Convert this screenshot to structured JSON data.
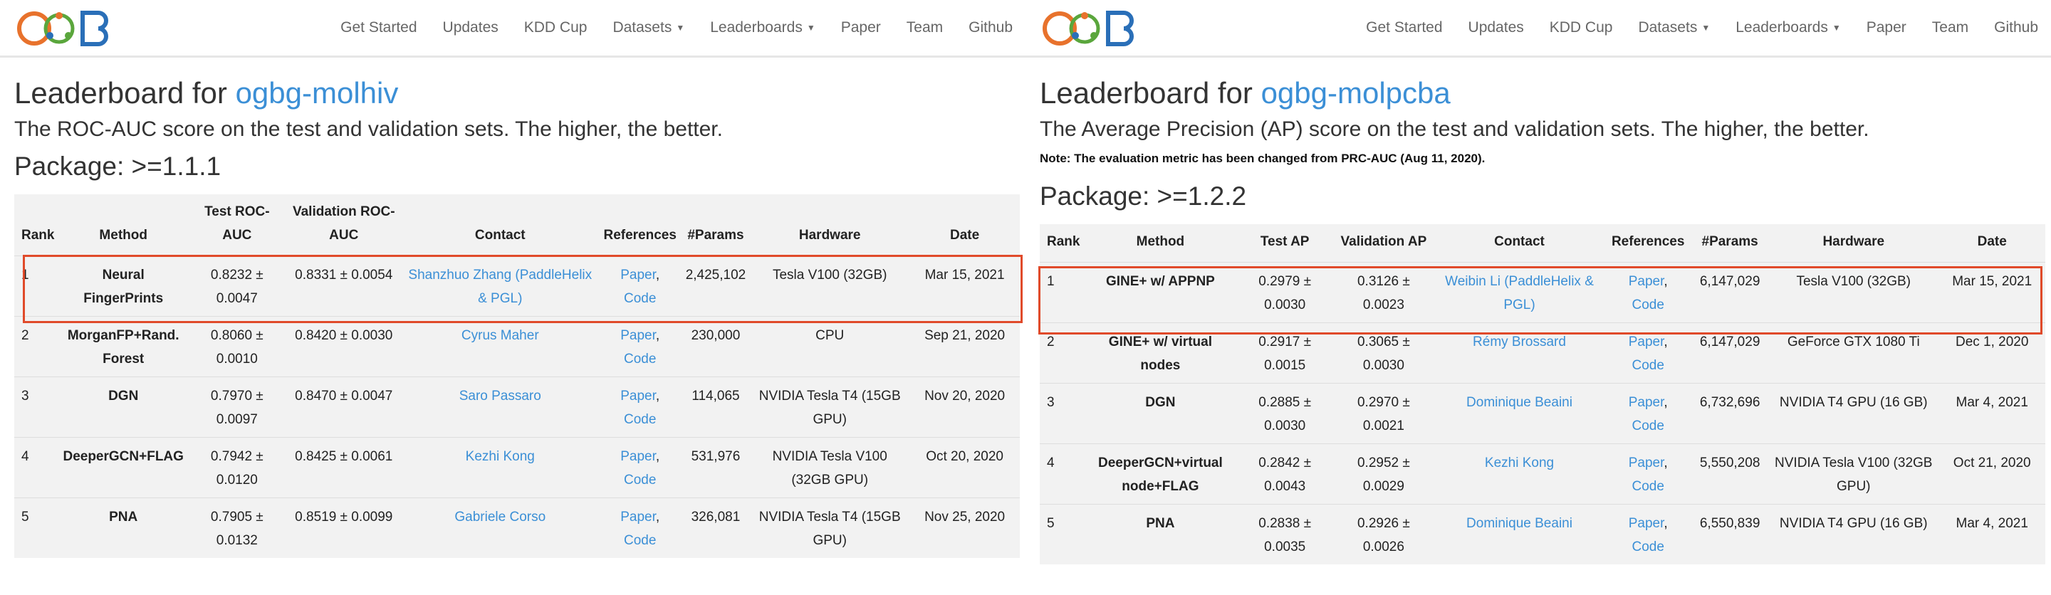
{
  "nav": {
    "links": [
      "Get Started",
      "Updates",
      "KDD Cup",
      "Datasets",
      "Leaderboards",
      "Paper",
      "Team",
      "Github"
    ]
  },
  "colors": {
    "link": "#3b8fd6",
    "highlight": "#e04a2a",
    "logo_orange": "#e8722c",
    "logo_blue": "#2a6fb8",
    "logo_green": "#5aa63c"
  },
  "left": {
    "title_prefix": "Leaderboard for",
    "dataset": "ogbg-molhiv",
    "subtitle": "The ROC-AUC score on the test and validation sets. The higher, the better.",
    "package": "Package: >=1.1.1",
    "headers": [
      "Rank",
      "Method",
      "Test ROC-AUC",
      "Validation ROC-AUC",
      "Contact",
      "References",
      "#Params",
      "Hardware",
      "Date"
    ],
    "rows": [
      {
        "rank": "1",
        "method": "Neural FingerPrints",
        "test": "0.8232 ± 0.0047",
        "valid": "0.8331 ± 0.0054",
        "contact": "Shanzhuo Zhang (PaddleHelix & PGL)",
        "paper": "Paper",
        "code": "Code",
        "params": "2,425,102",
        "hardware": "Tesla V100 (32GB)",
        "date": "Mar 15, 2021"
      },
      {
        "rank": "2",
        "method": "MorganFP+Rand. Forest",
        "test": "0.8060 ± 0.0010",
        "valid": "0.8420 ± 0.0030",
        "contact": "Cyrus Maher",
        "paper": "Paper",
        "code": "Code",
        "params": "230,000",
        "hardware": "CPU",
        "date": "Sep 21, 2020"
      },
      {
        "rank": "3",
        "method": "DGN",
        "test": "0.7970 ± 0.0097",
        "valid": "0.8470 ± 0.0047",
        "contact": "Saro Passaro",
        "paper": "Paper",
        "code": "Code",
        "params": "114,065",
        "hardware": "NVIDIA Tesla T4 (15GB GPU)",
        "date": "Nov 20, 2020"
      },
      {
        "rank": "4",
        "method": "DeeperGCN+FLAG",
        "test": "0.7942 ± 0.0120",
        "valid": "0.8425 ± 0.0061",
        "contact": "Kezhi Kong",
        "paper": "Paper",
        "code": "Code",
        "params": "531,976",
        "hardware": "NVIDIA Tesla V100 (32GB GPU)",
        "date": "Oct 20, 2020"
      },
      {
        "rank": "5",
        "method": "PNA",
        "test": "0.7905 ± 0.0132",
        "valid": "0.8519 ± 0.0099",
        "contact": "Gabriele Corso",
        "paper": "Paper",
        "code": "Code",
        "params": "326,081",
        "hardware": "NVIDIA Tesla T4 (15GB GPU)",
        "date": "Nov 25, 2020"
      }
    ]
  },
  "right": {
    "title_prefix": "Leaderboard for",
    "dataset": "ogbg-molpcba",
    "subtitle": "The Average Precision (AP) score on the test and validation sets. The higher, the better.",
    "note": "Note: The evaluation metric has been changed from PRC-AUC (Aug 11, 2020).",
    "package": "Package: >=1.2.2",
    "headers": [
      "Rank",
      "Method",
      "Test AP",
      "Validation AP",
      "Contact",
      "References",
      "#Params",
      "Hardware",
      "Date"
    ],
    "rows": [
      {
        "rank": "1",
        "method": "GINE+ w/ APPNP",
        "test": "0.2979 ± 0.0030",
        "valid": "0.3126 ± 0.0023",
        "contact": "Weibin Li (PaddleHelix & PGL)",
        "paper": "Paper",
        "code": "Code",
        "params": "6,147,029",
        "hardware": "Tesla V100 (32GB)",
        "date": "Mar 15, 2021"
      },
      {
        "rank": "2",
        "method": "GINE+ w/ virtual nodes",
        "test": "0.2917 ± 0.0015",
        "valid": "0.3065 ± 0.0030",
        "contact": "Rémy Brossard",
        "paper": "Paper",
        "code": "Code",
        "params": "6,147,029",
        "hardware": "GeForce GTX 1080 Ti",
        "date": "Dec 1, 2020"
      },
      {
        "rank": "3",
        "method": "DGN",
        "test": "0.2885 ± 0.0030",
        "valid": "0.2970 ± 0.0021",
        "contact": "Dominique Beaini",
        "paper": "Paper",
        "code": "Code",
        "params": "6,732,696",
        "hardware": "NVIDIA T4 GPU (16 GB)",
        "date": "Mar 4, 2021"
      },
      {
        "rank": "4",
        "method": "DeeperGCN+virtual node+FLAG",
        "test": "0.2842 ± 0.0043",
        "valid": "0.2952 ± 0.0029",
        "contact": "Kezhi Kong",
        "paper": "Paper",
        "code": "Code",
        "params": "5,550,208",
        "hardware": "NVIDIA Tesla V100 (32GB GPU)",
        "date": "Oct 21, 2020"
      },
      {
        "rank": "5",
        "method": "PNA",
        "test": "0.2838 ± 0.0035",
        "valid": "0.2926 ± 0.0026",
        "contact": "Dominique Beaini",
        "paper": "Paper",
        "code": "Code",
        "params": "6,550,839",
        "hardware": "NVIDIA T4 GPU (16 GB)",
        "date": "Mar 4, 2021"
      }
    ]
  }
}
